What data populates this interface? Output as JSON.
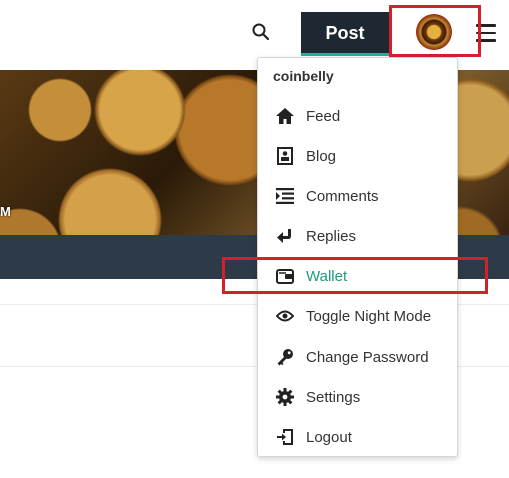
{
  "header": {
    "post_label": "Post",
    "icons": {
      "search": "search-icon",
      "avatar": "user-avatar",
      "menu": "hamburger-menu-icon"
    }
  },
  "hero": {
    "visible_text": "M"
  },
  "dropdown": {
    "username": "coinbelly",
    "items": [
      {
        "label": "Feed",
        "icon": "home-icon"
      },
      {
        "label": "Blog",
        "icon": "blog-icon"
      },
      {
        "label": "Comments",
        "icon": "comments-icon"
      },
      {
        "label": "Replies",
        "icon": "reply-icon"
      },
      {
        "label": "Wallet",
        "icon": "wallet-icon",
        "active": true
      },
      {
        "label": "Toggle Night Mode",
        "icon": "eye-icon"
      },
      {
        "label": "Change Password",
        "icon": "key-icon"
      },
      {
        "label": "Settings",
        "icon": "gear-icon"
      },
      {
        "label": "Logout",
        "icon": "logout-icon"
      }
    ]
  },
  "colors": {
    "accent": "#1c9b7e",
    "post_button_bg": "#1e2833",
    "highlight_box": "#d4202a",
    "dark_bar": "#2d3a48"
  }
}
